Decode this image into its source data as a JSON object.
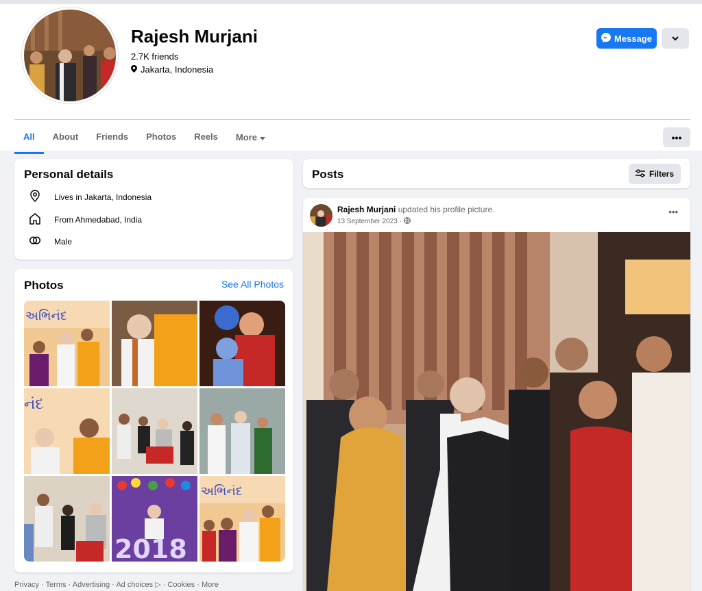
{
  "profile": {
    "name": "Rajesh Murjani",
    "friends": "2.7K friends",
    "location": "Jakarta, Indonesia",
    "message_label": "Message"
  },
  "tabs": [
    "All",
    "About",
    "Friends",
    "Photos",
    "Reels",
    "More"
  ],
  "personal_details": {
    "title": "Personal details",
    "items": [
      {
        "icon": "location-pin-icon",
        "text": "Lives in Jakarta, Indonesia"
      },
      {
        "icon": "home-icon",
        "text": "From Ahmedabad, India"
      },
      {
        "icon": "gender-icon",
        "text": "Male"
      }
    ]
  },
  "photos": {
    "title": "Photos",
    "see_all": "See All Photos"
  },
  "posts": {
    "title": "Posts",
    "filters_label": "Filters"
  },
  "post": {
    "author": "Rajesh Murjani",
    "action": "updated his profile picture.",
    "date": "13 September 2023 ·"
  },
  "footer": "Privacy · Terms · Advertising · Ad choices ▷ · Cookies · More",
  "colors": {
    "accent": "#1877f2",
    "background": "#f0f2f5",
    "secondary_text": "#65676b"
  }
}
